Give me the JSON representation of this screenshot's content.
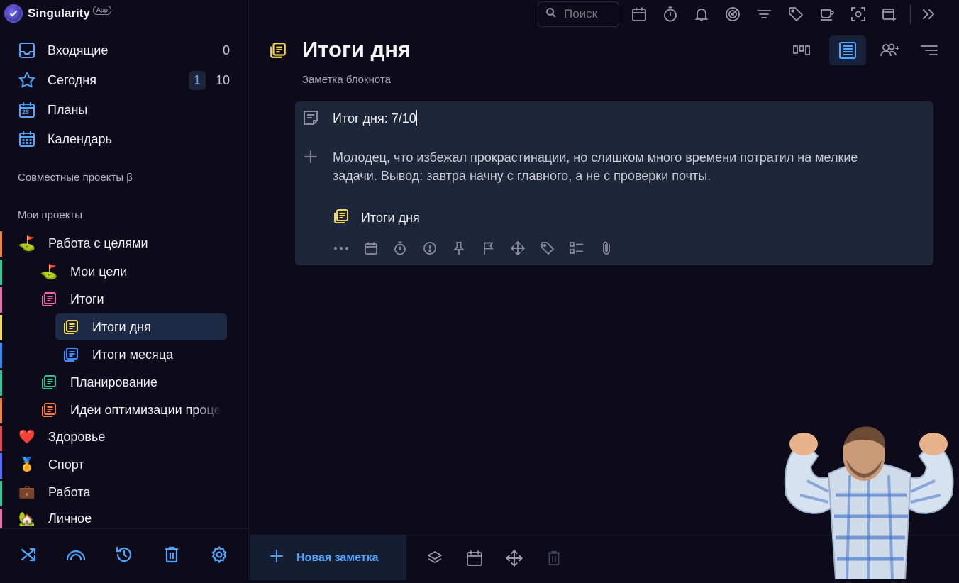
{
  "app": {
    "name": "Singularity",
    "badge": "App"
  },
  "sidebar": {
    "nav": [
      {
        "label": "Входящие",
        "count": "0"
      },
      {
        "label": "Сегодня",
        "count_active": "1",
        "count": "10"
      },
      {
        "label": "Планы",
        "icon_text": "28"
      },
      {
        "label": "Календарь"
      }
    ],
    "shared_projects_title": "Совместные проекты β",
    "my_projects_title": "Мои проекты",
    "projects": [
      {
        "label": "Работа с целями",
        "emoji": "⛳"
      },
      {
        "label": "Мои цели",
        "emoji": "⛳"
      },
      {
        "label": "Итоги"
      },
      {
        "label": "Итоги дня"
      },
      {
        "label": "Итоги месяца"
      },
      {
        "label": "Планирование"
      },
      {
        "label": "Идеи оптимизации процессов"
      },
      {
        "label": "Здоровье",
        "emoji": "❤️"
      },
      {
        "label": "Спорт",
        "emoji": "🏅"
      },
      {
        "label": "Работа",
        "emoji": "💼"
      },
      {
        "label": "Личное",
        "emoji": "🏡"
      }
    ],
    "colors": {
      "accent": "#4ea6ff",
      "yellow": "#f2d64b",
      "pink": "#e66aa8",
      "green": "#2fc48f",
      "blue": "#3b8cff",
      "orange": "#f27a3a"
    }
  },
  "toolbar": {
    "search_placeholder": "Поиск"
  },
  "page": {
    "title": "Итоги дня",
    "subtitle": "Заметка блокнота"
  },
  "note": {
    "title": "Итог дня: 7/10",
    "body": "Молодец, что избежал прокрастинации, но слишком много времени потратил на мелкие задачи. Вывод: завтра начну с главного, а не с проверки почты.",
    "parent": "Итоги дня"
  },
  "bottom": {
    "new_note_label": "Новая заметка"
  }
}
